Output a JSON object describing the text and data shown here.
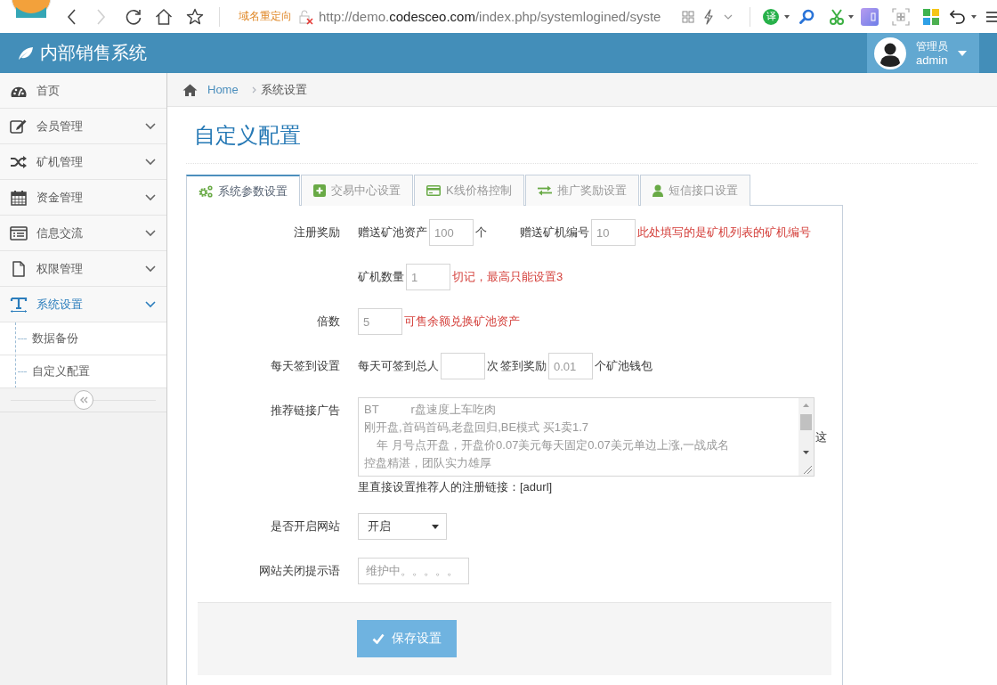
{
  "browser": {
    "forward_disabled": true,
    "redirect_label": "域名重定向",
    "url": {
      "prefix": "http://demo.",
      "domain": "codesceo.com",
      "path": "/index.php/systemlogined/syste"
    },
    "translate_label": "译"
  },
  "header": {
    "title": "内部销售系统",
    "user": {
      "role": "管理员",
      "name": "admin"
    }
  },
  "sidebar": {
    "items": [
      {
        "label": "首页",
        "expandable": false,
        "selected": false
      },
      {
        "label": "会员管理",
        "expandable": true,
        "selected": false
      },
      {
        "label": "矿机管理",
        "expandable": true,
        "selected": false
      },
      {
        "label": "资金管理",
        "expandable": true,
        "selected": false
      },
      {
        "label": "信息交流",
        "expandable": true,
        "selected": false
      },
      {
        "label": "权限管理",
        "expandable": true,
        "selected": false
      },
      {
        "label": "系统设置",
        "expandable": true,
        "selected": true,
        "children": [
          {
            "label": "数据备份"
          },
          {
            "label": "自定义配置"
          }
        ]
      }
    ]
  },
  "breadcrumb": [
    {
      "label": "Home",
      "kind": "link"
    },
    {
      "label": "系统设置",
      "kind": "current"
    }
  ],
  "page": {
    "title": "自定义配置"
  },
  "tabs": [
    {
      "label": "系统参数设置",
      "selected": true
    },
    {
      "label": "交易中心设置",
      "selected": false
    },
    {
      "label": "K线价格控制",
      "selected": false
    },
    {
      "label": "推广奖励设置",
      "selected": false
    },
    {
      "label": "短信接口设置",
      "selected": false
    }
  ],
  "form": {
    "rows": [
      {
        "label": "注册奖励",
        "kind": "inline",
        "groups": [
          [
            {
              "kind": "text",
              "text": "赠送矿池资产"
            },
            {
              "kind": "input",
              "value": "100"
            },
            {
              "kind": "text",
              "text": "个"
            }
          ],
          [
            {
              "kind": "text",
              "text": "赠送矿机编号"
            },
            {
              "kind": "input",
              "value": "10"
            },
            {
              "kind": "note",
              "text": "此处填写的是矿机列表的矿机编号"
            }
          ]
        ]
      },
      {
        "kind": "inline",
        "groups": [
          [
            {
              "kind": "text",
              "text": "矿机数量"
            },
            {
              "kind": "input",
              "value": "1"
            },
            {
              "kind": "note",
              "text": "切记，最高只能设置3"
            }
          ]
        ]
      },
      {
        "label": "倍数",
        "kind": "inline",
        "groups": [
          [
            {
              "kind": "input",
              "value": "5"
            },
            {
              "kind": "note",
              "text": "可售余额兑换矿池资产"
            }
          ]
        ]
      },
      {
        "label": "每天签到设置",
        "kind": "inline",
        "groups": [
          [
            {
              "kind": "text",
              "text": "每天可签到总人"
            },
            {
              "kind": "input"
            },
            {
              "kind": "text",
              "text": "次"
            },
            {
              "kind": "text",
              "text": "签到奖励"
            },
            {
              "kind": "input",
              "value": "0.01"
            },
            {
              "kind": "text",
              "text": "个矿池钱包"
            }
          ]
        ]
      },
      {
        "label": "推荐链接广告",
        "kind": "textarea",
        "lines": [
          "BT          r盘速度上车吃肉",
          "刚开盘,首码首码,老盘回归,BE模式 买1卖1.7",
          "    年 月号点开盘，开盘价0.07美元每天固定0.07美元单边上涨,一战成名",
          "控盘精湛，团队实力雄厚"
        ],
        "help_parts": [
          "这",
          "里直接设置推荐人的注册链接：[adurl]"
        ]
      },
      {
        "label": "是否开启网站",
        "kind": "select",
        "value": "开启"
      },
      {
        "label": "网站关闭提示语",
        "kind": "input",
        "value": "维护中。。。。。"
      }
    ],
    "save_label": "保存设置"
  }
}
